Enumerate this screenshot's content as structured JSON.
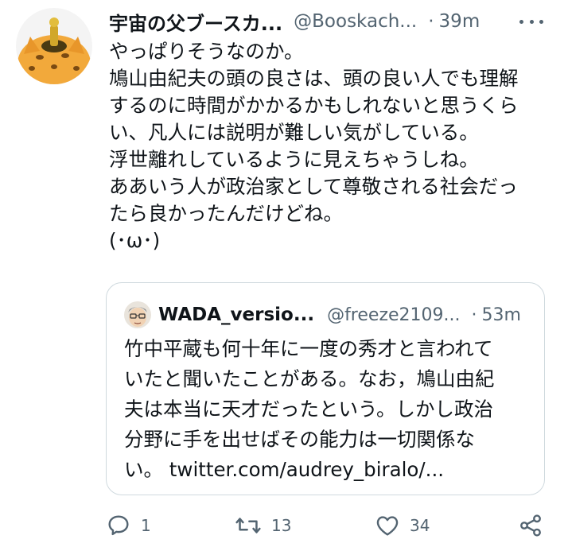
{
  "tweet": {
    "author_name": "宇宙の父ブースカ...",
    "author_handle": "@Booskach...",
    "separator": "·",
    "time": "39m",
    "text_lines": [
      "やっぱりそうなのか。",
      "鳩山由紀夫の頭の良さは、頭の良い人でも理解",
      "するのに時間がかかるかもしれないと思うくら",
      "い、凡人には説明が難しい気がしている。",
      "浮世離れしているように見えちゃうしね。",
      "ああいう人が政治家として尊敬される社会だっ",
      "たら良かったんだけどね。",
      "(･ω･)"
    ]
  },
  "quote": {
    "author_name": "WADA_versio...",
    "author_handle": "@freeze2109...",
    "separator": "·",
    "time": "53m",
    "text_lines": [
      "竹中平蔵も何十年に一度の秀才と言われて",
      "いたと聞いたことがある。なお，鳩山由紀",
      "夫は本当に天才だったという。しかし政治",
      "分野に手を出せばその能力は一切関係な"
    ],
    "last_line_prefix": "い。",
    "link_text": "twitter.com/audrey_biralo/..."
  },
  "actions": {
    "reply_count": "1",
    "retweet_count": "13",
    "like_count": "34"
  },
  "icons": {
    "avatar": "orange-cat-mascot-avatar",
    "quote_avatar": "cartoon-man-glasses-avatar",
    "more": "more-dots-icon",
    "reply": "reply-bubble-icon",
    "retweet": "retweet-icon",
    "like": "heart-icon",
    "share": "share-icon"
  },
  "colors": {
    "text": "#0f1419",
    "secondary": "#536471",
    "border": "#cfd9de"
  }
}
